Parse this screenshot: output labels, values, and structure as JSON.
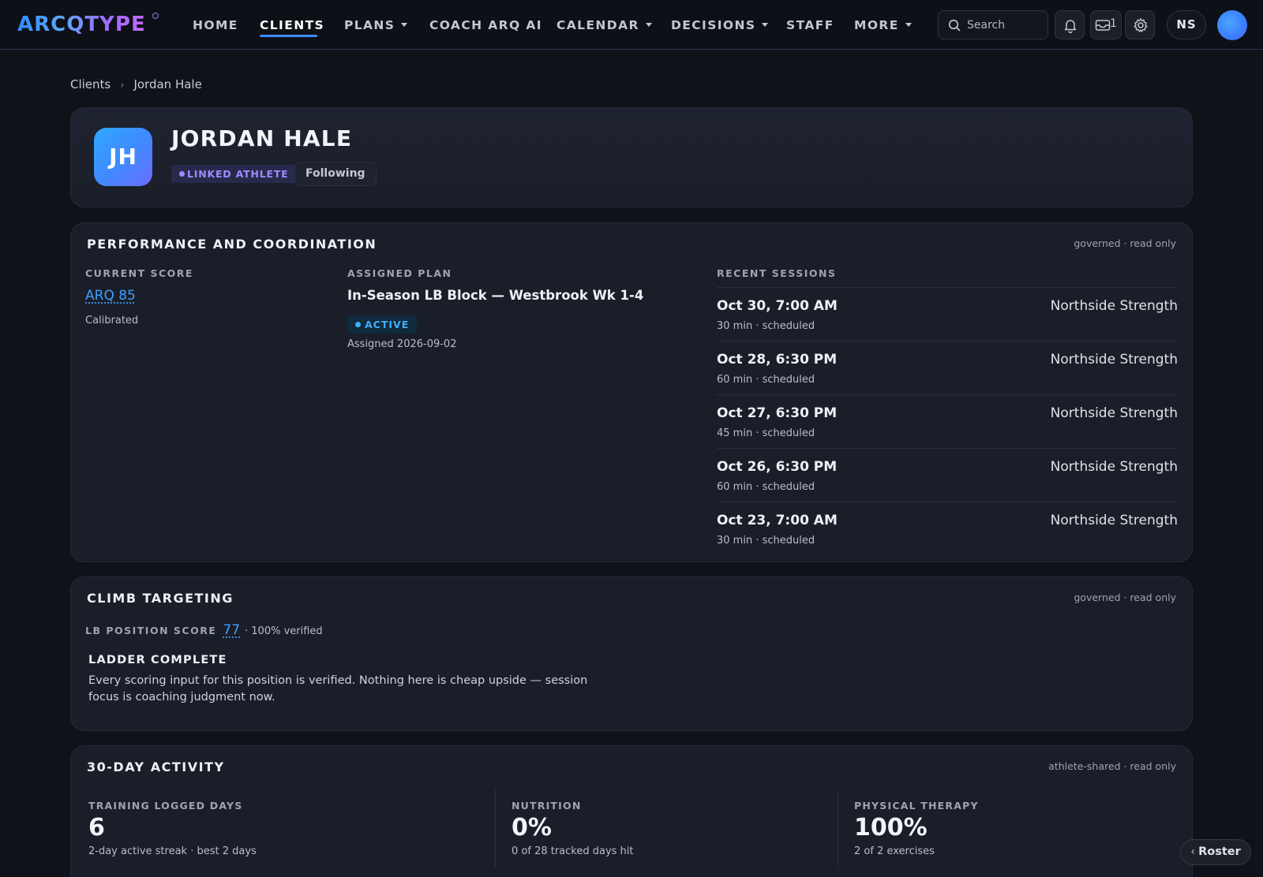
{
  "brand": {
    "logo_text": "ARCQTYPE"
  },
  "nav": {
    "items": [
      {
        "label": "HOME"
      },
      {
        "label": "CLIENTS"
      },
      {
        "label": "PLANS"
      },
      {
        "label": "COACH ARQ AI"
      },
      {
        "label": "CALENDAR"
      },
      {
        "label": "DECISIONS"
      },
      {
        "label": "STAFF"
      },
      {
        "label": "MORE"
      }
    ],
    "active": "CLIENTS",
    "search_placeholder": "Search",
    "inbox_count": "1",
    "user_initials": "NS"
  },
  "icons": {
    "search": "search-icon",
    "bell": "bell-icon",
    "inbox": "inbox-icon",
    "settings": "gear-icon",
    "chevron": "chevron-right-icon",
    "caret": "caret-down-icon"
  },
  "breadcrumb": {
    "root": "Clients",
    "current": "Jordan Hale"
  },
  "profile": {
    "initials": "JH",
    "name": "JORDAN HALE",
    "tag_linked": "LINKED ATHLETE",
    "tag_following": "Following"
  },
  "performance": {
    "title": "PERFORMANCE AND COORDINATION",
    "meta": "governed · read only",
    "current_score_label": "CURRENT SCORE",
    "score": "ARQ 85",
    "score_status": "Calibrated",
    "assigned_plan_label": "ASSIGNED PLAN",
    "plan_name": "In-Season LB Block — Westbrook Wk 1-4",
    "plan_status": "ACTIVE",
    "plan_assigned": "Assigned 2026-09-02",
    "recent_sessions_label": "RECENT SESSIONS",
    "sessions": [
      {
        "date": "Oct 30, 7:00 AM",
        "sub": "30 min · scheduled",
        "location": "Northside Strength"
      },
      {
        "date": "Oct 28, 6:30 PM",
        "sub": "60 min · scheduled",
        "location": "Northside Strength"
      },
      {
        "date": "Oct 27, 6:30 PM",
        "sub": "45 min · scheduled",
        "location": "Northside Strength"
      },
      {
        "date": "Oct 26, 6:30 PM",
        "sub": "60 min · scheduled",
        "location": "Northside Strength"
      },
      {
        "date": "Oct 23, 7:00 AM",
        "sub": "30 min · scheduled",
        "location": "Northside Strength"
      }
    ]
  },
  "climb": {
    "title": "CLIMB TARGETING",
    "meta": "governed · read only",
    "lb_label": "LB POSITION SCORE",
    "lb_score": "77",
    "lb_verified": "· 100% verified",
    "ladder_title": "LADDER COMPLETE",
    "ladder_text": "Every scoring input for this position is verified. Nothing here is cheap upside — session focus is coaching judgment now."
  },
  "activity": {
    "title": "30-DAY ACTIVITY",
    "meta": "athlete-shared · read only",
    "stats": [
      {
        "label": "TRAINING LOGGED DAYS",
        "value": "6",
        "sub": "2-day active streak · best 2 days"
      },
      {
        "label": "NUTRITION",
        "value": "0%",
        "sub": "0 of 28 tracked days hit"
      },
      {
        "label": "PHYSICAL THERAPY",
        "value": "100%",
        "sub": "2 of 2 exercises"
      }
    ]
  },
  "roster_button": "Roster",
  "colors": {
    "background": "#0f1218",
    "card": "#1a1e28",
    "accent_blue": "#3fa0ff",
    "accent_purple": "#9d8cff",
    "nav_underline": "#3d8bff"
  }
}
